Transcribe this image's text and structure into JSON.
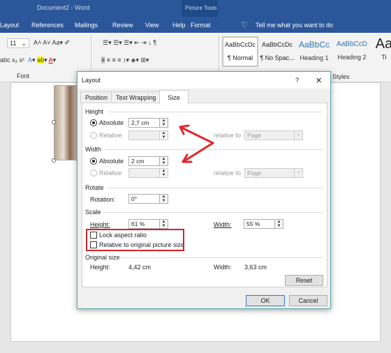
{
  "window": {
    "title": "Document2 - Word",
    "context_tab_group": "Picture Tools"
  },
  "ribbon_tabs": [
    "Layout",
    "References",
    "Mailings",
    "Review",
    "View",
    "Help",
    "Format"
  ],
  "tell_me": "Tell me what you want to do",
  "font": {
    "size": "11",
    "group_label": "Font"
  },
  "styles": {
    "items": [
      {
        "preview": "AaBbCcDc",
        "label": "¶ Normal"
      },
      {
        "preview": "AaBbCcDc",
        "label": "¶ No Spac..."
      },
      {
        "preview": "AaBbCc",
        "label": "Heading 1"
      },
      {
        "preview": "AaBbCcD",
        "label": "Heading 2"
      },
      {
        "preview": "Aa",
        "label": "Ti"
      }
    ],
    "group_label": "Styles"
  },
  "dialog": {
    "title": "Layout",
    "help": "?",
    "close": "✕",
    "tabs": [
      "Position",
      "Text Wrapping",
      "Size"
    ],
    "active_tab": "Size",
    "height": {
      "label": "Height",
      "absolute_label": "Absolute",
      "absolute_value": "2,7 cm",
      "relative_label": "Relative",
      "relative_value": "",
      "relative_to_label": "relative to",
      "relative_to_value": "Page"
    },
    "width": {
      "label": "Width",
      "absolute_label": "Absolute",
      "absolute_value": "2 cm",
      "relative_label": "Relative",
      "relative_value": "",
      "relative_to_label": "relative to",
      "relative_to_value": "Page"
    },
    "rotate": {
      "label": "Rotate",
      "rotation_label": "Rotation:",
      "rotation_value": "0°"
    },
    "scale": {
      "label": "Scale",
      "height_label": "Height:",
      "height_value": "61 %",
      "width_label": "Width:",
      "width_value": "55 %",
      "lock_aspect_ratio": "Lock aspect ratio",
      "lock_checked": false,
      "relative_original": "Relative to original picture size",
      "relative_checked": false
    },
    "original_size": {
      "label": "Original size",
      "height_label": "Height:",
      "height_value": "4,42 cm",
      "width_label": "Width:",
      "width_value": "3,63 cm"
    },
    "reset": "Reset",
    "ok": "OK",
    "cancel": "Cancel"
  },
  "colors": {
    "ribbon_blue": "#2b579a",
    "annotation_red": "#e0262b"
  }
}
